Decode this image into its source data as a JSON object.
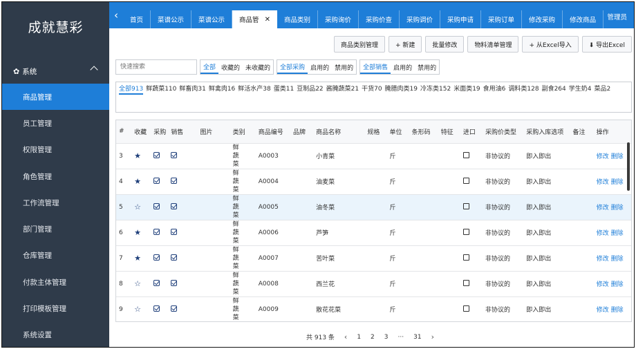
{
  "app": {
    "logo": "成就慧彩",
    "user": "管理员"
  },
  "sidebar": {
    "section": "系统",
    "items": [
      {
        "label": "商品管理",
        "active": true
      },
      {
        "label": "员工管理"
      },
      {
        "label": "权限管理"
      },
      {
        "label": "角色管理"
      },
      {
        "label": "工作流管理"
      },
      {
        "label": "部门管理"
      },
      {
        "label": "仓库管理"
      },
      {
        "label": "付款主体管理"
      },
      {
        "label": "打印模板管理"
      },
      {
        "label": "系统设置"
      }
    ]
  },
  "tabs": [
    "首页",
    "菜谱公示",
    "菜谱公示",
    "商品管",
    "商品类别",
    "采购询价",
    "采购价查",
    "采购调价",
    "采购申请",
    "采购订单",
    "修改采购",
    "修改商品"
  ],
  "toolbar": {
    "category_mgmt": "商品类别管理",
    "new": "+ 新建",
    "batch_edit": "批量修改",
    "bom_mgmt": "物料清单管理",
    "import_excel": "+ 从Excel导入",
    "export_excel": "⬇ 导出Excel"
  },
  "filters": {
    "search_placeholder": "快速搜索",
    "fav": [
      "全部",
      "收藏的",
      "未收藏的"
    ],
    "purchase": [
      "全部采购",
      "启用的",
      "禁用的"
    ],
    "sales": [
      "全部销售",
      "启用的",
      "禁用的"
    ]
  },
  "categories": [
    "全部913",
    "鲜蔬菜110",
    "鲜畜肉31",
    "鲜禽肉16",
    "鲜活水产38",
    "蛋类11",
    "豆制品22",
    "酱腌蔬菜21",
    "干货70",
    "腌腊肉类19",
    "冷冻类152",
    "米面类19",
    "食用油6",
    "调料类128",
    "副食264",
    "学生奶4",
    "菜品2"
  ],
  "table": {
    "headers": [
      "#",
      "收藏",
      "采购",
      "销售",
      "图片",
      "类别",
      "商品编号",
      "品牌",
      "商品名称",
      "规格",
      "单位",
      "条形码",
      "特征",
      "进口",
      "采购价类型",
      "采购入库选项",
      "备注",
      "操作"
    ],
    "edit_label": "修改",
    "delete_label": "删除",
    "rows": [
      {
        "no": "3",
        "fav": true,
        "category": "鲜蔬菜",
        "code": "A0003",
        "name": "小青菜",
        "unit": "斤",
        "price_type": "非协议的",
        "stock_opt": "即入即出"
      },
      {
        "no": "4",
        "fav": true,
        "category": "鲜蔬菜",
        "code": "A0004",
        "name": "油麦菜",
        "unit": "斤",
        "price_type": "非协议的",
        "stock_opt": "即入即出"
      },
      {
        "no": "5",
        "fav": false,
        "category": "鲜蔬菜",
        "code": "A0005",
        "name": "油冬菜",
        "unit": "斤",
        "price_type": "非协议的",
        "stock_opt": "即入即出",
        "highlight": true
      },
      {
        "no": "6",
        "fav": true,
        "category": "鲜蔬菜",
        "code": "A0006",
        "name": "芦笋",
        "unit": "斤",
        "price_type": "非协议的",
        "stock_opt": "即入即出"
      },
      {
        "no": "7",
        "fav": true,
        "category": "鲜蔬菜",
        "code": "A0007",
        "name": "苦叶菜",
        "unit": "斤",
        "price_type": "非协议的",
        "stock_opt": "即入即出"
      },
      {
        "no": "8",
        "fav": false,
        "category": "鲜蔬菜",
        "code": "A0008",
        "name": "西兰花",
        "unit": "斤",
        "price_type": "非协议的",
        "stock_opt": "即入即出"
      },
      {
        "no": "9",
        "fav": false,
        "category": "鲜蔬菜",
        "code": "A0009",
        "name": "散花花菜",
        "unit": "斤",
        "price_type": "非协议的",
        "stock_opt": "即入即出"
      }
    ]
  },
  "pagination": {
    "total": "共 913 条",
    "pages": [
      "1",
      "2",
      "3",
      "···",
      "31"
    ]
  },
  "colors": {
    "sidebar": "#2f3b4a",
    "accent": "#1e7ed8",
    "icon": "#1f3f7a"
  }
}
